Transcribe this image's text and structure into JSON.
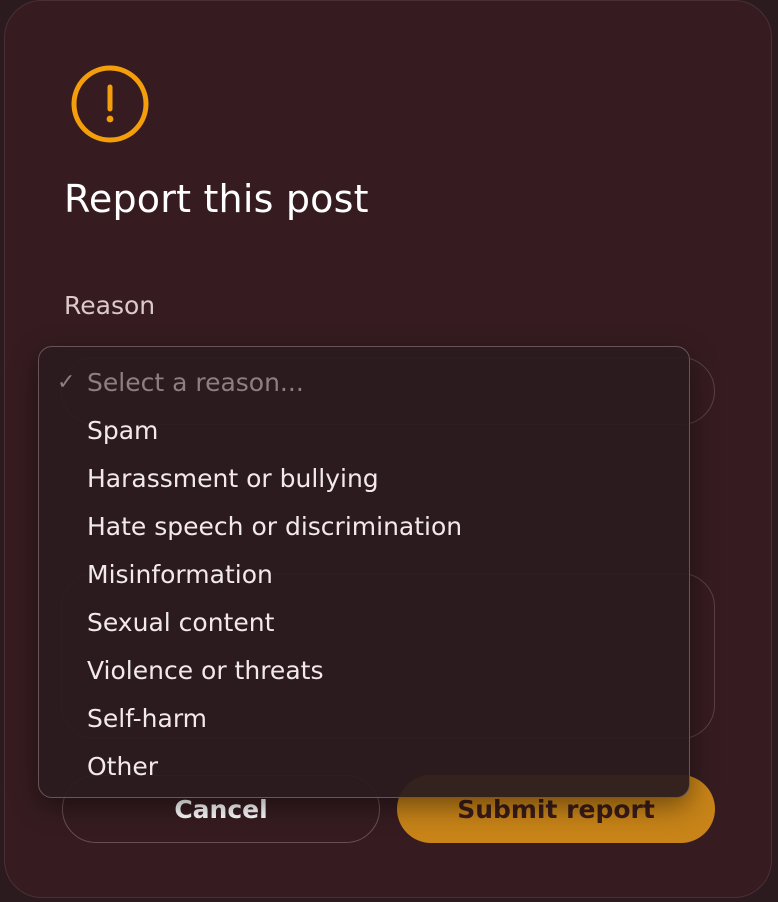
{
  "dialog": {
    "title": "Report this post",
    "reason_label": "Reason",
    "icon": "warning-circle-icon",
    "accent_color": "#f59e0b"
  },
  "reason_select": {
    "selected": "Select a reason...",
    "options": [
      "Select a reason...",
      "Spam",
      "Harassment or bullying",
      "Hate speech or discrimination",
      "Misinformation",
      "Sexual content",
      "Violence or threats",
      "Self-harm",
      "Other"
    ]
  },
  "buttons": {
    "cancel": "Cancel",
    "submit": "Submit report"
  },
  "colors": {
    "modal_bg": "#361c20",
    "submit_bg": "#c88418"
  }
}
